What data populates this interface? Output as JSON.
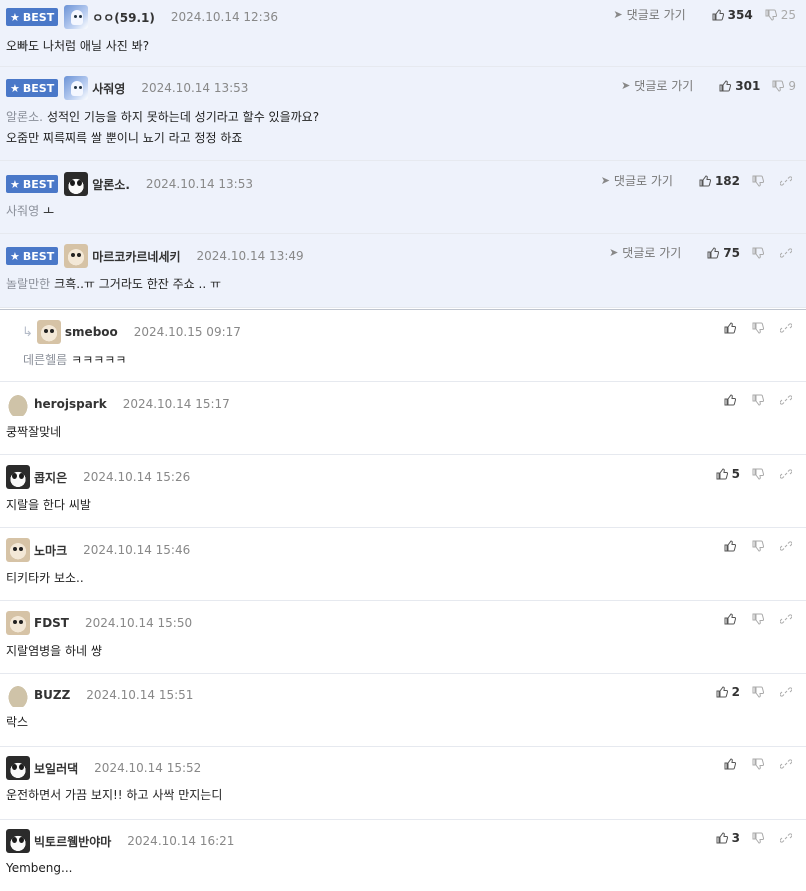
{
  "labels": {
    "best": "BEST",
    "reply_link": "댓글로 가기"
  },
  "comments": [
    {
      "nick": "ㅇㅇ(59.1)",
      "date": "2024.10.14 12:36",
      "up": "354",
      "down": "25",
      "quote": "",
      "lines": [
        "오빠도 나처럼 애닐 사진 봐?"
      ]
    },
    {
      "nick": "사줘영",
      "date": "2024.10.14 13:53",
      "up": "301",
      "down": "9",
      "quote": "알론소.",
      "lines": [
        "성적인 기능을 하지 못하는데 성기라고 할수 있을까요?",
        "오줌만 찌륵찌륵 쌀 뿐이니 뇨기 라고 정정 하죠"
      ]
    },
    {
      "nick": "알론소.",
      "date": "2024.10.14 13:53",
      "up": "182",
      "down": "",
      "quote": "사줘영",
      "lines": [
        "ㅗ"
      ]
    },
    {
      "nick": "마르코카르네세키",
      "date": "2024.10.14 13:49",
      "up": "75",
      "down": "",
      "quote": "놀랄만한",
      "lines": [
        "크흑..ㅠ 그거라도 한잔 주쇼 .. ㅠ"
      ]
    },
    {
      "nick": "smeboo",
      "date": "2024.10.15 09:17",
      "up": "",
      "down": "",
      "quote": "데른헬름",
      "lines": [
        "ㅋㅋㅋㅋㅋ"
      ]
    },
    {
      "nick": "herojspark",
      "date": "2024.10.14 15:17",
      "up": "",
      "down": "",
      "quote": "",
      "lines": [
        "쿵짝잘맞네"
      ]
    },
    {
      "nick": "콥지은",
      "date": "2024.10.14 15:26",
      "up": "5",
      "down": "",
      "quote": "",
      "lines": [
        "지랄을 한다 씨발"
      ]
    },
    {
      "nick": "노마크",
      "date": "2024.10.14 15:46",
      "up": "",
      "down": "",
      "quote": "",
      "lines": [
        "티키타카 보소.."
      ]
    },
    {
      "nick": "FDST",
      "date": "2024.10.14 15:50",
      "up": "",
      "down": "",
      "quote": "",
      "lines": [
        "지랄염병을 하네 썅"
      ]
    },
    {
      "nick": "BUZZ",
      "date": "2024.10.14 15:51",
      "up": "2",
      "down": "",
      "quote": "",
      "lines": [
        "락스"
      ]
    },
    {
      "nick": "보일러댁",
      "date": "2024.10.14 15:52",
      "up": "",
      "down": "",
      "quote": "",
      "lines": [
        "운전하면서 가끔 보지!! 하고 사싹 만지는디"
      ]
    },
    {
      "nick": "빅토르웸반야마",
      "date": "2024.10.14 16:21",
      "up": "3",
      "down": "",
      "quote": "",
      "lines": [
        "Yembeng..."
      ]
    }
  ]
}
